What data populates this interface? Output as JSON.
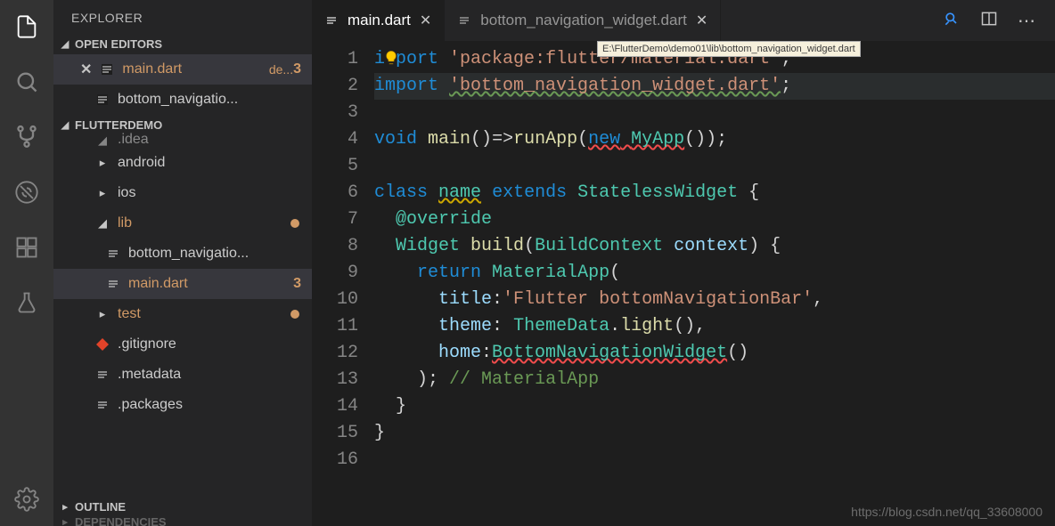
{
  "sidebar": {
    "title": "EXPLORER",
    "sections": {
      "open_editors": {
        "label": "OPEN EDITORS",
        "items": [
          {
            "name": "main.dart",
            "secondary": "de...",
            "badge": "3",
            "active": true
          },
          {
            "name": "bottom_navigatio..."
          }
        ]
      },
      "project": {
        "label": "FLUTTERDEMO",
        "items": [
          {
            "name": ".idea",
            "kind": "folder",
            "expanded": true,
            "truncated": true
          },
          {
            "name": "android",
            "kind": "folder"
          },
          {
            "name": "ios",
            "kind": "folder"
          },
          {
            "name": "lib",
            "kind": "folder",
            "expanded": true,
            "modified": true,
            "dot": true
          },
          {
            "name": "bottom_navigatio...",
            "kind": "dart",
            "indent": 2
          },
          {
            "name": "main.dart",
            "kind": "dart",
            "indent": 2,
            "active": true,
            "modified": true,
            "badge": "3"
          },
          {
            "name": "test",
            "kind": "folder",
            "modified": true,
            "dot": true
          },
          {
            "name": ".gitignore",
            "kind": "git"
          },
          {
            "name": ".metadata",
            "kind": "file"
          },
          {
            "name": ".packages",
            "kind": "file"
          }
        ]
      },
      "outline": {
        "label": "OUTLINE"
      },
      "dependencies": {
        "label": "DEPENDENCIES"
      }
    }
  },
  "tabs": [
    {
      "name": "main.dart",
      "active": true
    },
    {
      "name": "bottom_navigation_widget.dart",
      "active": false
    }
  ],
  "tooltip": "E:\\FlutterDemo\\demo01\\lib\\bottom_navigation_widget.dart",
  "editor": {
    "line_count": 16,
    "lines": [
      {
        "n": 1,
        "html": "<span class='kw'>i<span style='position:relative;display:inline-block;width:12px'>&nbsp;</span>port</span> <span class='str'>'package:flutter/material.dart'</span><span class='pl'>;</span>"
      },
      {
        "n": 2,
        "hl": true,
        "html": "<span class='kw'>import</span> <span class='str wavy-g'>'bottom_navigation_widget.dart'</span><span class='pl'>;</span>"
      },
      {
        "n": 3,
        "html": ""
      },
      {
        "n": 4,
        "html": "<span class='kw'>void</span> <span class='fn'>main</span><span class='pl'>()</span><span class='op'>=&gt;</span><span class='fn'>runApp</span><span class='pl'>(</span><span class='kw wavy-r'>new</span><span class='wavy-r'> </span><span class='cls wavy-r'>MyApp</span><span class='pl'>());</span>"
      },
      {
        "n": 5,
        "html": ""
      },
      {
        "n": 6,
        "html": "<span class='kw'>class</span> <span class='cls wavy-o'>name</span> <span class='kw'>extends</span> <span class='cls'>StatelessWidget</span> <span class='pl'>{</span>"
      },
      {
        "n": 7,
        "html": "  <span class='ann'>@override</span>"
      },
      {
        "n": 8,
        "html": "  <span class='cls'>Widget</span> <span class='fn'>build</span><span class='pl'>(</span><span class='cls'>BuildContext</span> <span class='prop'>context</span><span class='pl'>) {</span>"
      },
      {
        "n": 9,
        "html": "    <span class='kw'>return</span> <span class='cls'>MaterialApp</span><span class='pl'>(</span>"
      },
      {
        "n": 10,
        "html": "      <span class='prop'>title</span><span class='pl'>:</span><span class='str'>'Flutter bottomNavigationBar'</span><span class='pl'>,</span>"
      },
      {
        "n": 11,
        "html": "      <span class='prop'>theme</span><span class='pl'>:</span> <span class='cls'>ThemeData</span><span class='pl'>.</span><span class='fn'>light</span><span class='pl'>(),</span>"
      },
      {
        "n": 12,
        "html": "      <span class='prop'>home</span><span class='pl'>:</span><span class='cls wavy-r'>BottomNavigationWidget</span><span class='pl'>()</span>"
      },
      {
        "n": 13,
        "html": "    <span class='pl'>);</span> <span class='cmt'>// MaterialApp</span>"
      },
      {
        "n": 14,
        "html": "  <span class='pl'>}</span>"
      },
      {
        "n": 15,
        "html": "<span class='pl'>}</span>"
      },
      {
        "n": 16,
        "html": ""
      }
    ]
  },
  "watermark": "https://blog.csdn.net/qq_33608000"
}
